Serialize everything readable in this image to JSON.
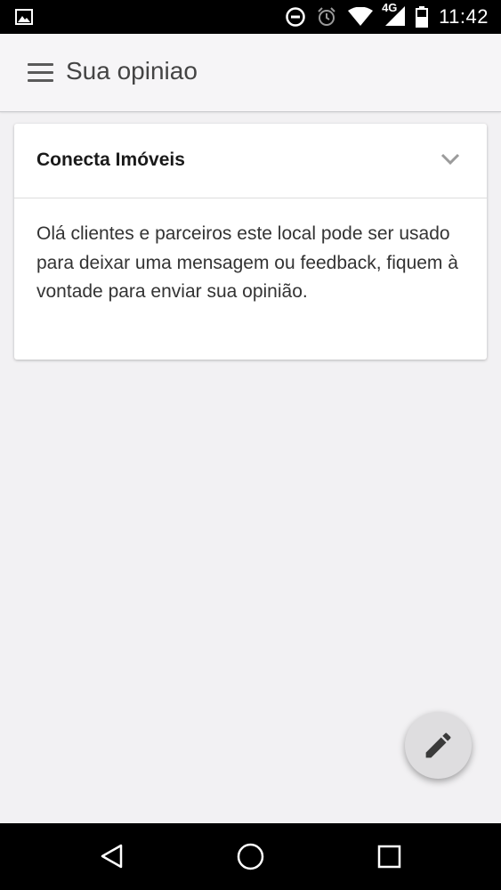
{
  "status_bar": {
    "time": "11:42",
    "network": "4G",
    "icons": [
      "gallery-icon",
      "do-not-disturb-icon",
      "alarm-icon",
      "wifi-icon",
      "signal-icon",
      "battery-icon"
    ]
  },
  "app_bar": {
    "title": "Sua opiniao",
    "menu_icon": "hamburger-menu-icon"
  },
  "card": {
    "title": "Conecta Imóveis",
    "expand_icon": "chevron-down-icon",
    "message": "Olá clientes e parceiros este local pode ser usado para deixar uma mensagem ou feedback, fiquem à vontade para enviar sua opinião."
  },
  "fab": {
    "icon": "pencil-icon"
  },
  "nav_bar": {
    "icons": [
      "back-icon",
      "home-icon",
      "recents-icon"
    ]
  },
  "colors": {
    "background": "#f2f1f3",
    "app_bar": "#f6f5f7",
    "card": "#ffffff",
    "fab": "#dedddf",
    "system_bars": "#000000"
  }
}
